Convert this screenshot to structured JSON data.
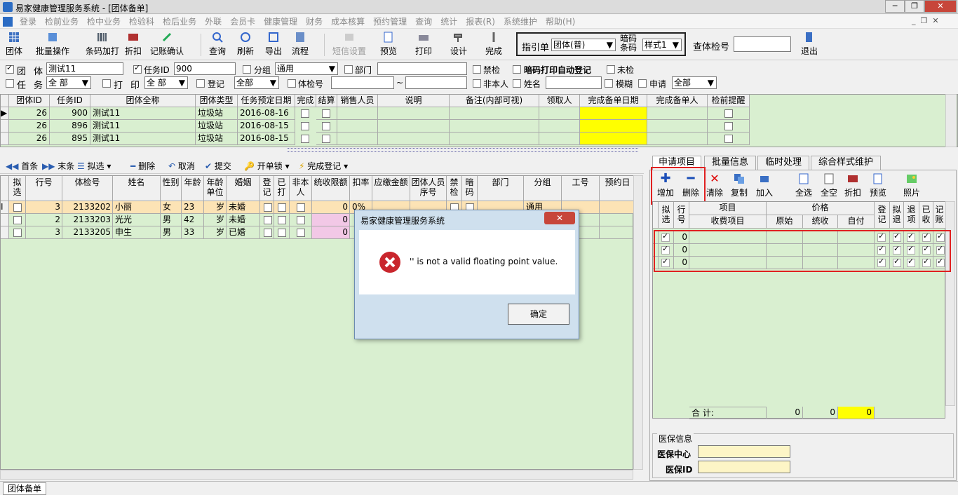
{
  "titlebar": {
    "title": "易家健康管理服务系统 - [团体备单]",
    "min": "─",
    "max": "❐",
    "close": "✕"
  },
  "menu": [
    "登录",
    "检前业务",
    "检中业务",
    "检验科",
    "检后业务",
    "外联",
    "会员卡",
    "健康管理",
    "财务",
    "成本核算",
    "预约管理",
    "查询",
    "统计",
    "报表(R)",
    "系统维护",
    "帮助(H)"
  ],
  "toolbar": {
    "group": "团体",
    "batch": "批量操作",
    "barcode": "条码加打",
    "discount": "折扣",
    "account": "记账确认",
    "query": "查询",
    "refresh": "刷新",
    "export": "导出",
    "flow": "流程",
    "sms": "短信设置",
    "preview": "预览",
    "print": "打印",
    "design": "设计",
    "finish": "完成",
    "guide_label": "指引单",
    "guide_value": "团体(普)",
    "code_label1": "暗码",
    "code_label2": "条码",
    "style_value": "样式1",
    "check_label": "查体检号",
    "exit": "退出"
  },
  "filters": {
    "group_label": "团",
    "group_label2": "体",
    "group_value": "测试11",
    "taskid_label": "任务ID",
    "taskid_value": "900",
    "subgroup_label": "分组",
    "subgroup_value": "通用",
    "dept_label": "部门",
    "ban_label": "禁检",
    "dark_label": "暗码打印自动登记",
    "notcheck_label": "未检",
    "task_label": "任",
    "task_label2": "务",
    "task_value": "全 部",
    "print_label": "打",
    "print_label2": "印",
    "print_value": "全 部",
    "reg_label": "登记",
    "reg_value": "全部",
    "exam_label": "体检号",
    "tilde": "~",
    "nonself_label": "非本人",
    "name_label": "姓名",
    "fuzzy_label": "模糊",
    "apply_label": "申请",
    "apply_value": "全部"
  },
  "top_grid": {
    "headers": [
      "团体ID",
      "任务ID",
      "团体全称",
      "团体类型",
      "任务预定日期",
      "完成",
      "结算",
      "销售人员",
      "说明",
      "备注(内部可视)",
      "领取人",
      "完成备单日期",
      "完成备单人",
      "检前提醒"
    ],
    "rows": [
      [
        "26",
        "900",
        "测试11",
        "垃圾站",
        "2016-08-16"
      ],
      [
        "26",
        "896",
        "测试11",
        "垃圾站",
        "2016-08-15"
      ],
      [
        "26",
        "895",
        "测试11",
        "垃圾站",
        "2016-08-15"
      ]
    ]
  },
  "subtoolbar": {
    "first": "首条",
    "last": "末条",
    "select": "拟选",
    "delete": "删除",
    "cancel": "取消",
    "submit": "提交",
    "unlock": "开单锁",
    "complete": "完成登记"
  },
  "main_grid": {
    "headers": [
      "拟选",
      "行号",
      "体检号",
      "姓名",
      "性别",
      "年龄",
      "年龄单位",
      "婚姻",
      "登记",
      "已打",
      "非本人",
      "统收限额",
      "扣率",
      "应缴金额",
      "团体人员序号",
      "禁检",
      "暗码",
      "部门",
      "分组",
      "工号",
      "预约日"
    ],
    "rows": [
      [
        "3",
        "2133202",
        "小丽",
        "女",
        "23",
        "岁",
        "未婚",
        "0",
        "0%",
        "通用"
      ],
      [
        "2",
        "2133203",
        "光光",
        "男",
        "42",
        "岁",
        "未婚",
        "0",
        "",
        ""
      ],
      [
        "3",
        "2133205",
        "申生",
        "男",
        "33",
        "岁",
        "已婚",
        "0",
        "",
        ""
      ]
    ]
  },
  "tabs": [
    "申请项目",
    "批量信息",
    "临时处理",
    "综合样式维护"
  ],
  "right_toolbar": {
    "add": "增加",
    "delete": "删除",
    "clear": "清除",
    "copy": "复制",
    "join": "加入",
    "selall": "全选",
    "clearall": "全空",
    "discount": "折扣",
    "preview": "预览",
    "photo": "照片"
  },
  "right_grid": {
    "h_select": "拟选",
    "h_row": "行号",
    "h_item": "项目",
    "h_price": "价格",
    "h_fee": "收费项目",
    "h_orig": "原始",
    "h_collect": "统收",
    "h_self": "自付",
    "h_reg": "登记",
    "h_pre": "拟退",
    "h_ret": "退项",
    "h_recv": "已收",
    "h_acct": "记账",
    "rows": [
      "0",
      "0",
      "0"
    ],
    "total_label": "合   计:",
    "total_orig": "0",
    "total_collect": "0",
    "total_self": "0"
  },
  "medical": {
    "title": "医保信息",
    "center": "医保中心",
    "id": "医保ID"
  },
  "dialog": {
    "title": "易家健康管理服务系统",
    "close": "✕",
    "message": "'' is not a valid floating point value.",
    "ok": "确定"
  },
  "status": {
    "tab": "团体备单"
  }
}
